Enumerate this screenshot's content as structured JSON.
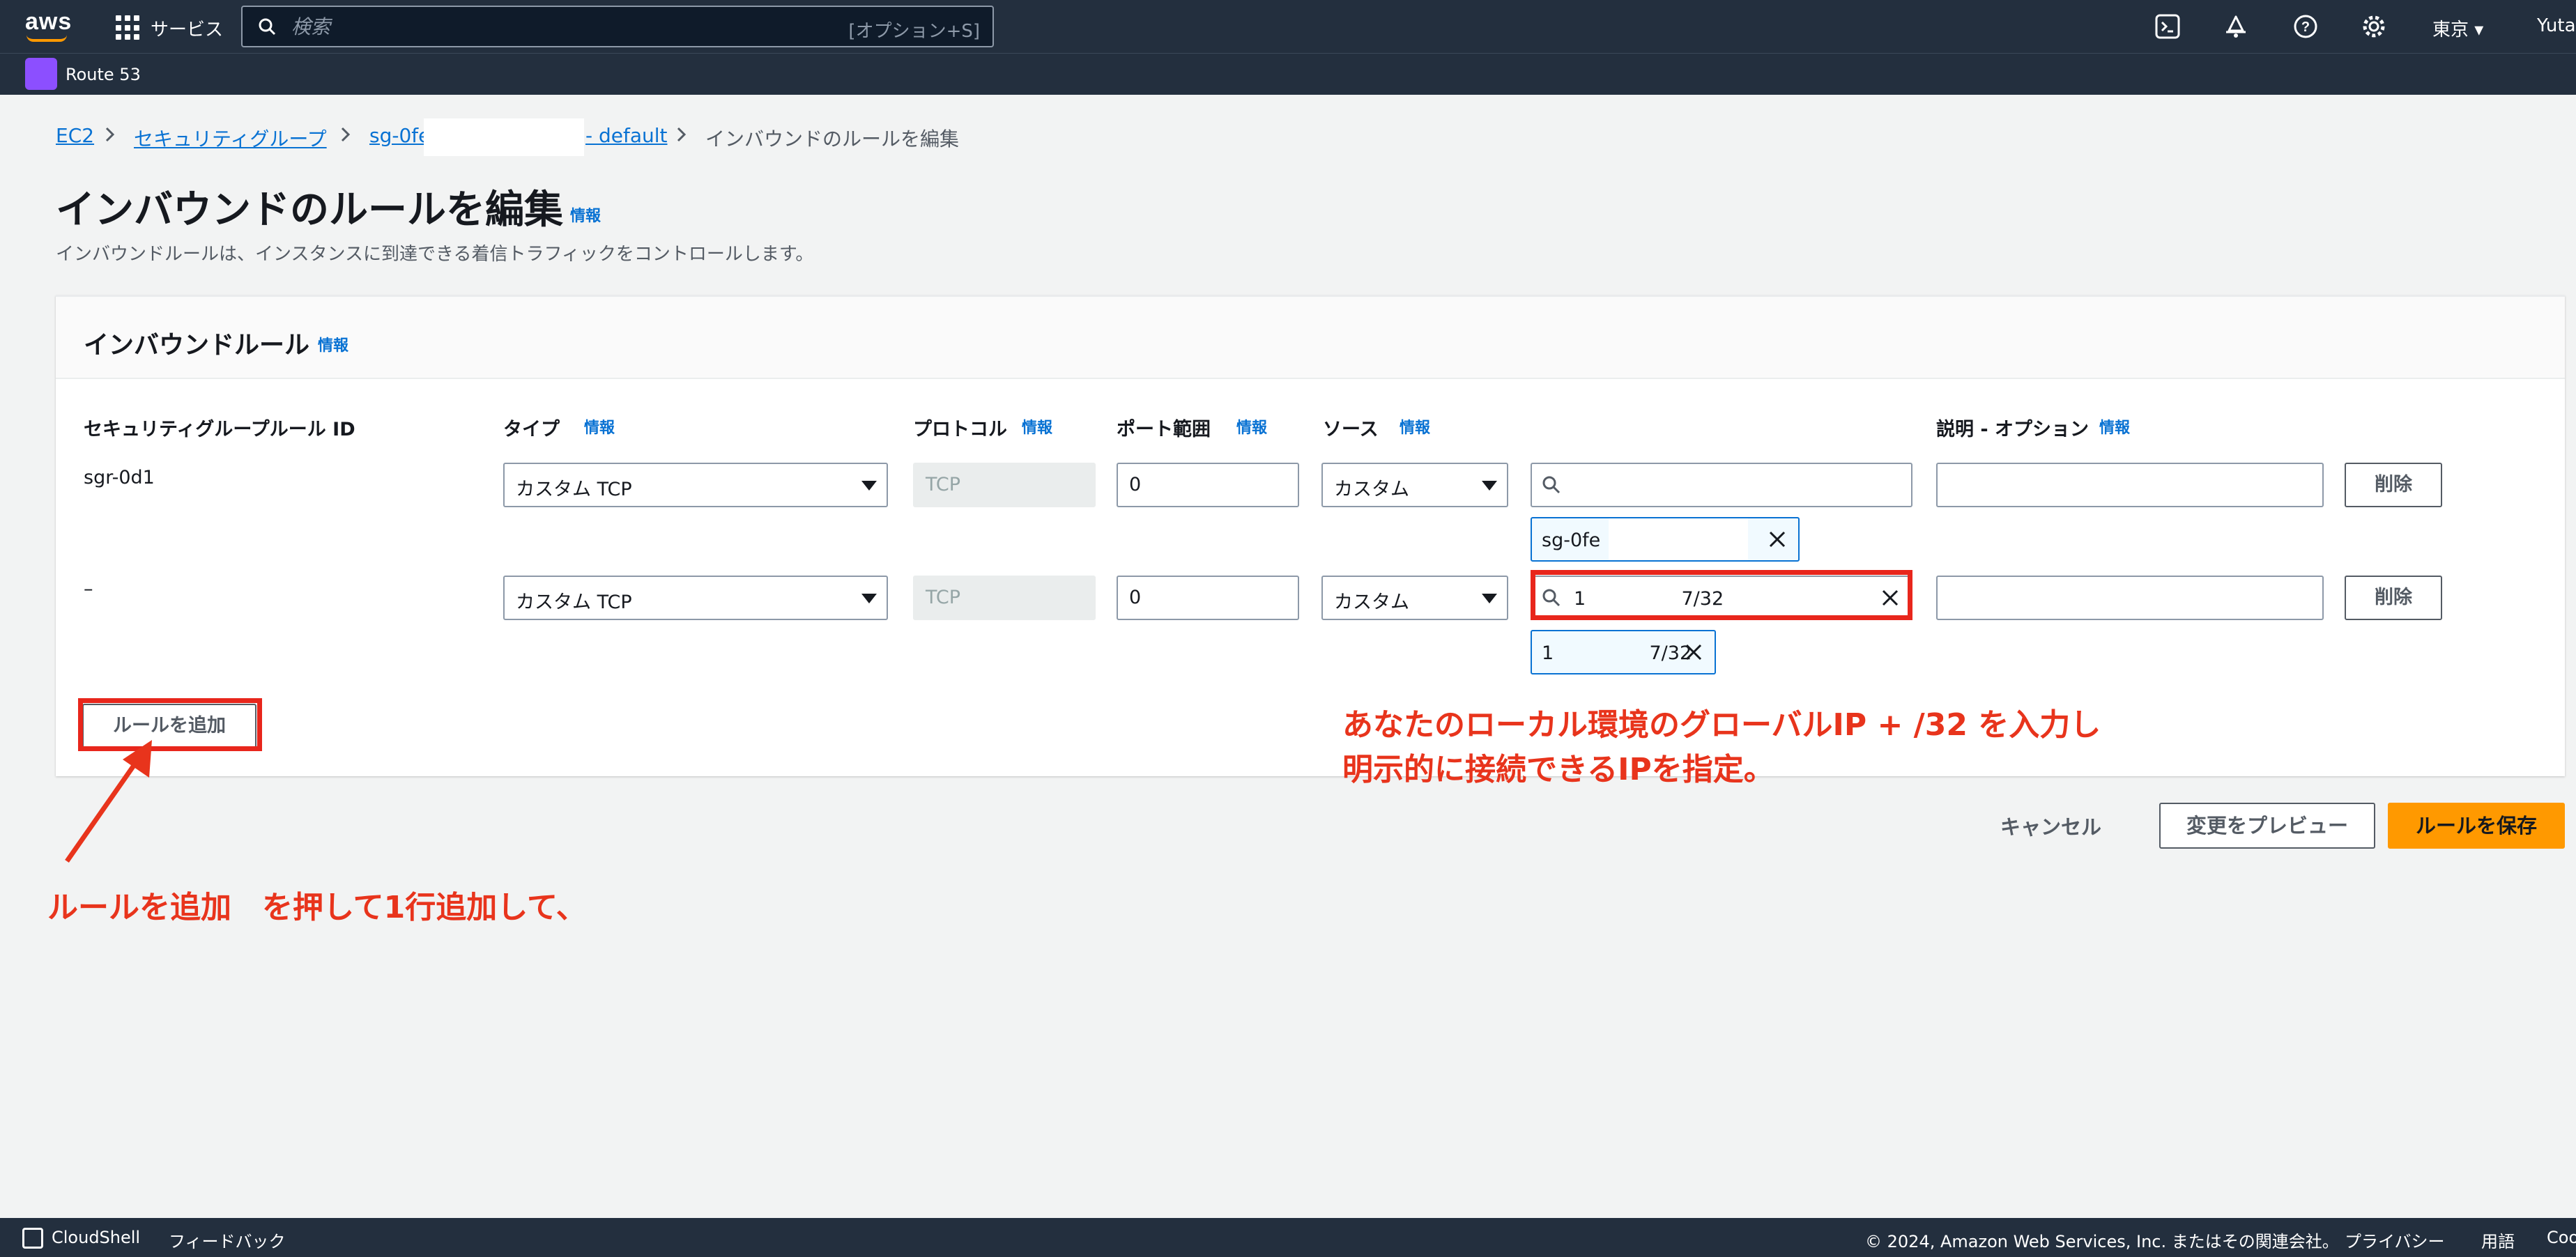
{
  "topnav": {
    "logo_text": "aws",
    "services_label": "サービス",
    "search_placeholder": "検索",
    "search_shortcut": "[オプション+S]",
    "region": "東京 ▾",
    "user": "Yuta"
  },
  "servicebar": {
    "service": "Route 53"
  },
  "breadcrumb": {
    "ec2": "EC2",
    "security_groups": "セキュリティグループ",
    "sg_prefix": "sg-0fe",
    "sg_suffix": "- default",
    "current": "インバウンドのルールを編集"
  },
  "header": {
    "title": "インバウンドのルールを編集",
    "info": "情報",
    "description": "インバウンドルールは、インスタンスに到達できる着信トラフィックをコントロールします。"
  },
  "rules_panel": {
    "title": "インバウンドルール",
    "info": "情報",
    "columns": {
      "rule_id": "セキュリティグループルール ID",
      "type": "タイプ",
      "protocol": "プロトコル",
      "port_range": "ポート範囲",
      "source": "ソース",
      "description": "説明 - オプション",
      "info": "情報"
    },
    "rows": [
      {
        "rule_id": "sgr-0d1",
        "type": "カスタム TCP",
        "protocol": "TCP",
        "port": "0",
        "source_type": "カスタム",
        "source_search": "",
        "source_token": "sg-0fe",
        "description": "",
        "delete": "削除"
      },
      {
        "rule_id": "–",
        "type": "カスタム TCP",
        "protocol": "TCP",
        "port": "0",
        "source_type": "カスタム",
        "source_search": "1                7/32",
        "source_token": "1                7/32",
        "description": "",
        "delete": "削除"
      }
    ],
    "add_rule": "ルールを追加"
  },
  "actions": {
    "cancel": "キャンセル",
    "preview": "変更をプレビュー",
    "save": "ルールを保存"
  },
  "annotations": {
    "line1": "あなたのローカル環境のグローバルIP + /32 を入力し",
    "line2": "明示的に接続できるIPを指定。",
    "add_rule_note": "ルールを追加　を押して1行追加して、",
    "color": "#e8341c"
  },
  "bottombar": {
    "cloudshell": "CloudShell",
    "feedback": "フィードバック",
    "copyright": "© 2024, Amazon Web Services, Inc. またはその関連会社。",
    "privacy": "プライバシー",
    "terms": "用語",
    "cookie": "Cookie"
  }
}
